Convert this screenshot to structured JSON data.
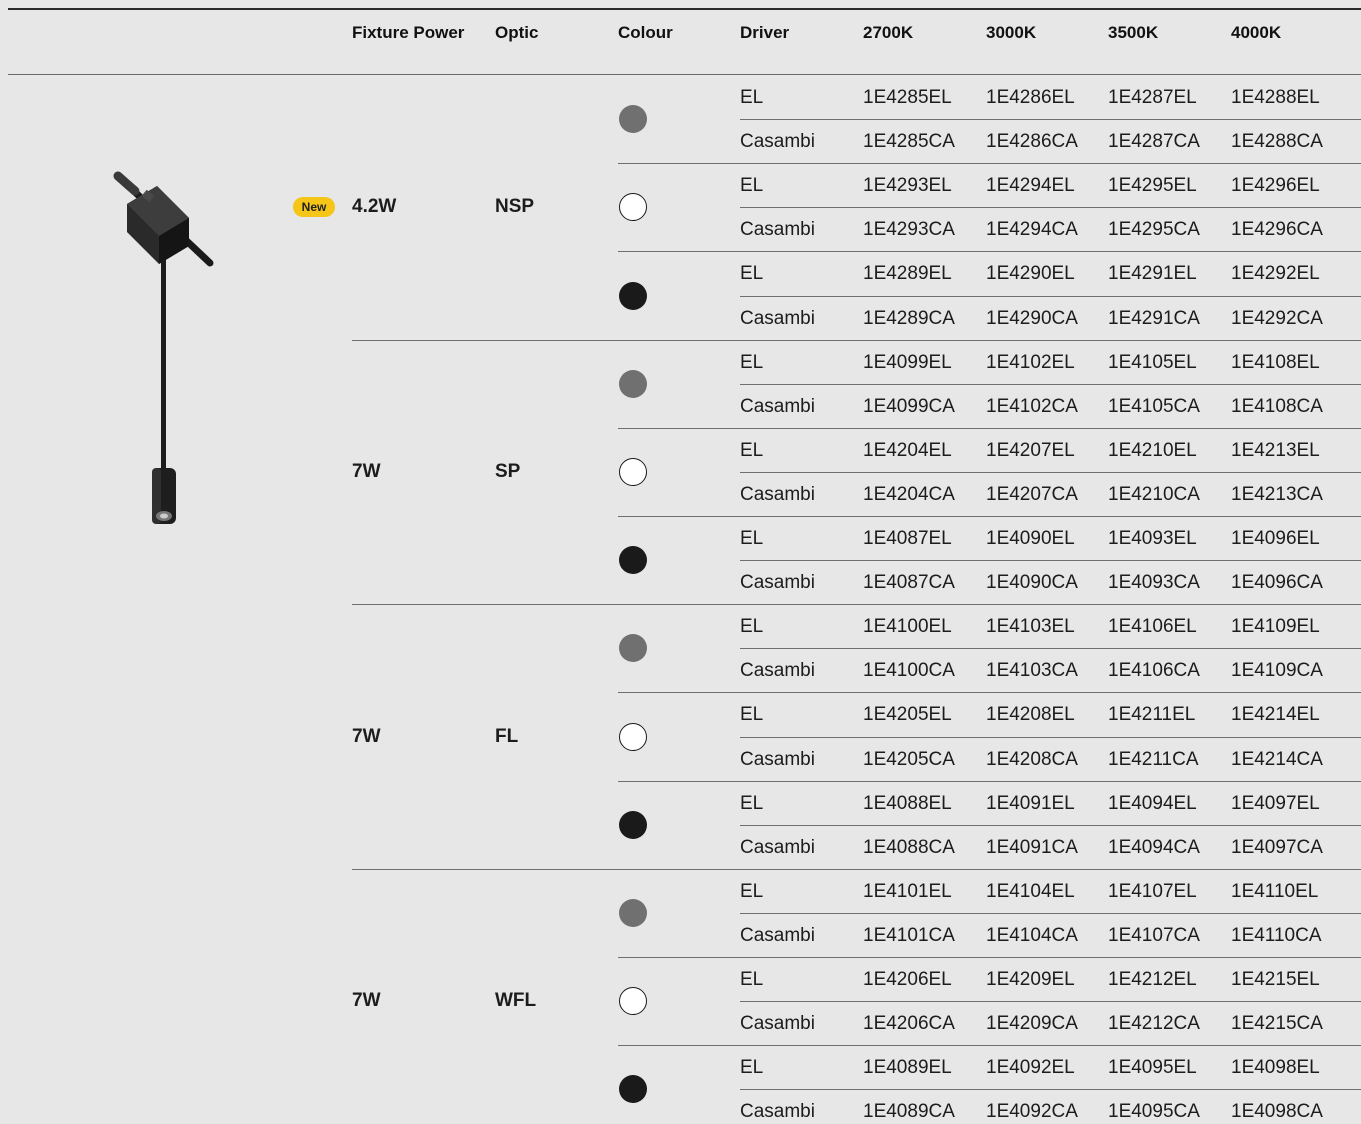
{
  "columns": {
    "fixture_power": "Fixture Power",
    "optic": "Optic",
    "colour": "Colour",
    "driver": "Driver",
    "temps": [
      "2700K",
      "3000K",
      "3500K",
      "4000K"
    ]
  },
  "badge": "New",
  "colours": {
    "grey": "#707070",
    "white": "#ffffff",
    "black": "#1a1a1a"
  },
  "groups": [
    {
      "power": "4.2W",
      "optic": "NSP",
      "new": true,
      "rows": [
        {
          "colour": "grey",
          "driver": "EL",
          "codes": [
            "1E4285EL",
            "1E4286EL",
            "1E4287EL",
            "1E4288EL"
          ]
        },
        {
          "colour": "grey",
          "driver": "Casambi",
          "codes": [
            "1E4285CA",
            "1E4286CA",
            "1E4287CA",
            "1E4288CA"
          ]
        },
        {
          "colour": "white",
          "driver": "EL",
          "codes": [
            "1E4293EL",
            "1E4294EL",
            "1E4295EL",
            "1E4296EL"
          ]
        },
        {
          "colour": "white",
          "driver": "Casambi",
          "codes": [
            "1E4293CA",
            "1E4294CA",
            "1E4295CA",
            "1E4296CA"
          ]
        },
        {
          "colour": "black",
          "driver": "EL",
          "codes": [
            "1E4289EL",
            "1E4290EL",
            "1E4291EL",
            "1E4292EL"
          ]
        },
        {
          "colour": "black",
          "driver": "Casambi",
          "codes": [
            "1E4289CA",
            "1E4290CA",
            "1E4291CA",
            "1E4292CA"
          ]
        }
      ]
    },
    {
      "power": "7W",
      "optic": "SP",
      "new": false,
      "rows": [
        {
          "colour": "grey",
          "driver": "EL",
          "codes": [
            "1E4099EL",
            "1E4102EL",
            "1E4105EL",
            "1E4108EL"
          ]
        },
        {
          "colour": "grey",
          "driver": "Casambi",
          "codes": [
            "1E4099CA",
            "1E4102CA",
            "1E4105CA",
            "1E4108CA"
          ]
        },
        {
          "colour": "white",
          "driver": "EL",
          "codes": [
            "1E4204EL",
            "1E4207EL",
            "1E4210EL",
            "1E4213EL"
          ]
        },
        {
          "colour": "white",
          "driver": "Casambi",
          "codes": [
            "1E4204CA",
            "1E4207CA",
            "1E4210CA",
            "1E4213CA"
          ]
        },
        {
          "colour": "black",
          "driver": "EL",
          "codes": [
            "1E4087EL",
            "1E4090EL",
            "1E4093EL",
            "1E4096EL"
          ]
        },
        {
          "colour": "black",
          "driver": "Casambi",
          "codes": [
            "1E4087CA",
            "1E4090CA",
            "1E4093CA",
            "1E4096CA"
          ]
        }
      ]
    },
    {
      "power": "7W",
      "optic": "FL",
      "new": false,
      "rows": [
        {
          "colour": "grey",
          "driver": "EL",
          "codes": [
            "1E4100EL",
            "1E4103EL",
            "1E4106EL",
            "1E4109EL"
          ]
        },
        {
          "colour": "grey",
          "driver": "Casambi",
          "codes": [
            "1E4100CA",
            "1E4103CA",
            "1E4106CA",
            "1E4109CA"
          ]
        },
        {
          "colour": "white",
          "driver": "EL",
          "codes": [
            "1E4205EL",
            "1E4208EL",
            "1E4211EL",
            "1E4214EL"
          ]
        },
        {
          "colour": "white",
          "driver": "Casambi",
          "codes": [
            "1E4205CA",
            "1E4208CA",
            "1E4211CA",
            "1E4214CA"
          ]
        },
        {
          "colour": "black",
          "driver": "EL",
          "codes": [
            "1E4088EL",
            "1E4091EL",
            "1E4094EL",
            "1E4097EL"
          ]
        },
        {
          "colour": "black",
          "driver": "Casambi",
          "codes": [
            "1E4088CA",
            "1E4091CA",
            "1E4094CA",
            "1E4097CA"
          ]
        }
      ]
    },
    {
      "power": "7W",
      "optic": "WFL",
      "new": false,
      "rows": [
        {
          "colour": "grey",
          "driver": "EL",
          "codes": [
            "1E4101EL",
            "1E4104EL",
            "1E4107EL",
            "1E4110EL"
          ]
        },
        {
          "colour": "grey",
          "driver": "Casambi",
          "codes": [
            "1E4101CA",
            "1E4104CA",
            "1E4107CA",
            "1E4110CA"
          ]
        },
        {
          "colour": "white",
          "driver": "EL",
          "codes": [
            "1E4206EL",
            "1E4209EL",
            "1E4212EL",
            "1E4215EL"
          ]
        },
        {
          "colour": "white",
          "driver": "Casambi",
          "codes": [
            "1E4206CA",
            "1E4209CA",
            "1E4212CA",
            "1E4215CA"
          ]
        },
        {
          "colour": "black",
          "driver": "EL",
          "codes": [
            "1E4089EL",
            "1E4092EL",
            "1E4095EL",
            "1E4098EL"
          ]
        },
        {
          "colour": "black",
          "driver": "Casambi",
          "codes": [
            "1E4089CA",
            "1E4092CA",
            "1E4095CA",
            "1E4098CA"
          ]
        }
      ]
    }
  ]
}
